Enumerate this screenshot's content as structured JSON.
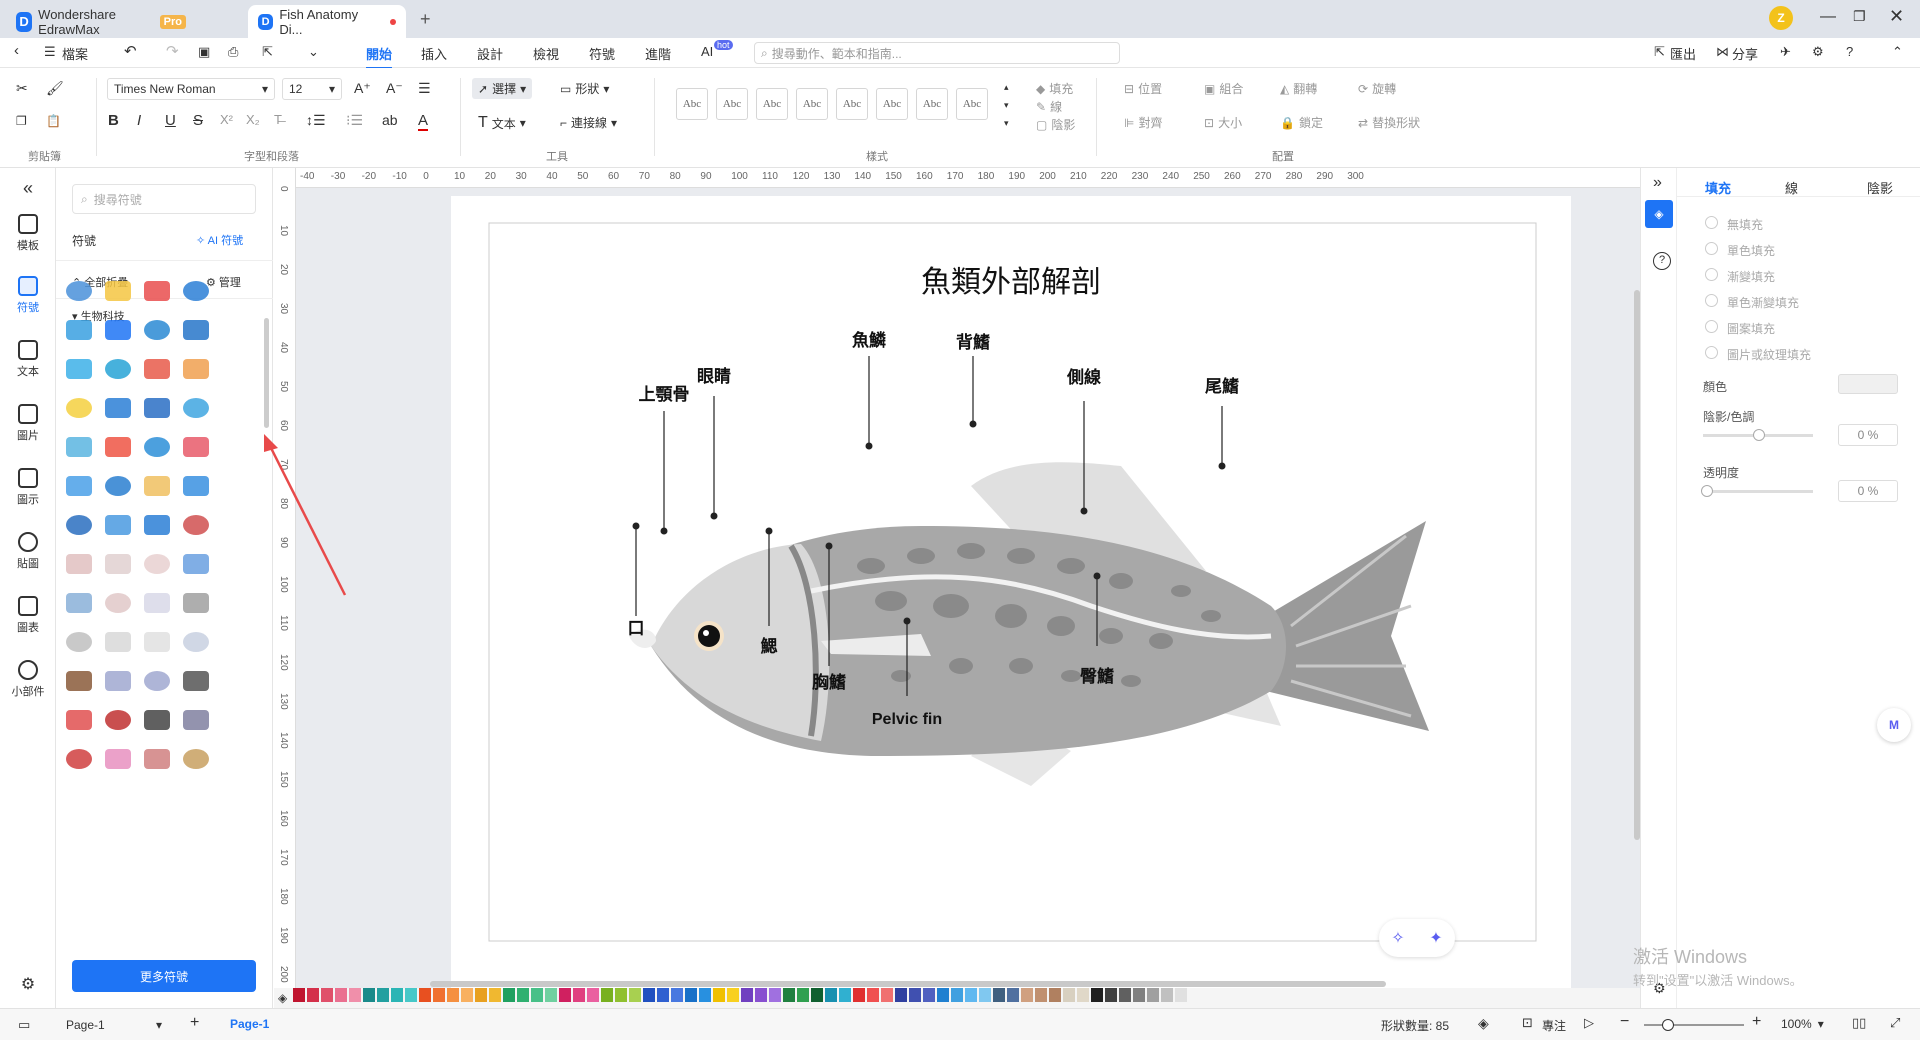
{
  "tabs": [
    {
      "label": "Wondershare EdrawMax",
      "badge": "Pro"
    },
    {
      "label": "Fish Anatomy Di..."
    }
  ],
  "user_initial": "Z",
  "menu": {
    "file": "檔案",
    "tabs": [
      "開始",
      "插入",
      "設計",
      "檢視",
      "符號",
      "進階",
      "AI"
    ],
    "ai_badge": "hot",
    "search_placeholder": "搜尋動作、範本和指南...",
    "export": "匯出",
    "share": "分享"
  },
  "ribbon": {
    "font_name": "Times New Roman",
    "font_size": "12",
    "select": "選擇",
    "shape": "形狀",
    "text": "文本",
    "connector": "連接線",
    "style_sample": "Abc",
    "fill": "填充",
    "line": "線",
    "shadow": "陰影",
    "position": "位置",
    "group": "組合",
    "flip": "翻轉",
    "rotate": "旋轉",
    "align": "對齊",
    "size": "大小",
    "lock": "鎖定",
    "replace": "替換形狀",
    "groups": [
      "剪貼簿",
      "字型和段落",
      "工具",
      "樣式",
      "配置"
    ]
  },
  "leftnav": [
    {
      "label": "模板"
    },
    {
      "label": "符號"
    },
    {
      "label": "文本"
    },
    {
      "label": "圖片"
    },
    {
      "label": "圖示"
    },
    {
      "label": "貼圖"
    },
    {
      "label": "圖表"
    },
    {
      "label": "小部件"
    }
  ],
  "symbols": {
    "search_placeholder": "搜尋符號",
    "title": "符號",
    "ai_label": "AI 符號",
    "collapse_all": "全部折疊",
    "manage": "管理",
    "category": "生物科技",
    "more_button": "更多符號"
  },
  "ruler": {
    "h": [
      "-40",
      "-30",
      "-20",
      "-10",
      "0",
      "10",
      "20",
      "30",
      "40",
      "50",
      "60",
      "70",
      "80",
      "90",
      "100",
      "110",
      "120",
      "130",
      "140",
      "150",
      "160",
      "170",
      "180",
      "190",
      "200",
      "210",
      "220",
      "230",
      "240",
      "250",
      "260",
      "270",
      "280",
      "290",
      "300"
    ],
    "v": [
      "0",
      "10",
      "20",
      "30",
      "40",
      "50",
      "60",
      "70",
      "80",
      "90",
      "100",
      "110",
      "120",
      "130",
      "140",
      "150",
      "160",
      "170",
      "180",
      "190",
      "200"
    ]
  },
  "diagram": {
    "title": "魚類外部解剖",
    "labels": {
      "scales": "魚鱗",
      "dorsal": "背鰭",
      "eye": "眼睛",
      "maxilla": "上顎骨",
      "lateral": "側線",
      "caudal": "尾鰭",
      "mouth": "口",
      "gill": "鰓",
      "pectoral": "胸鰭",
      "anal": "臀鰭",
      "pelvic": "Pelvic fin"
    }
  },
  "rpanel": {
    "tabs": [
      "填充",
      "線",
      "陰影"
    ],
    "fill_options": [
      "無填充",
      "單色填充",
      "漸變填充",
      "單色漸變填充",
      "圖案填充",
      "圖片或紋理填充"
    ],
    "color_label": "顏色",
    "shade_label": "陰影/色調",
    "shade_value": "0 %",
    "transparency_label": "透明度",
    "transparency_value": "0 %",
    "colors": {
      "accent": "#1e74f5",
      "selected_tab": "#1e74f5"
    }
  },
  "watermark": {
    "line1": "激活 Windows",
    "line2": "转到\"设置\"以激活 Windows。"
  },
  "status": {
    "page_dropdown": "Page-1",
    "page_tab": "Page-1",
    "shape_count": "形狀數量: 85",
    "focus": "專注",
    "zoom": "100%"
  }
}
